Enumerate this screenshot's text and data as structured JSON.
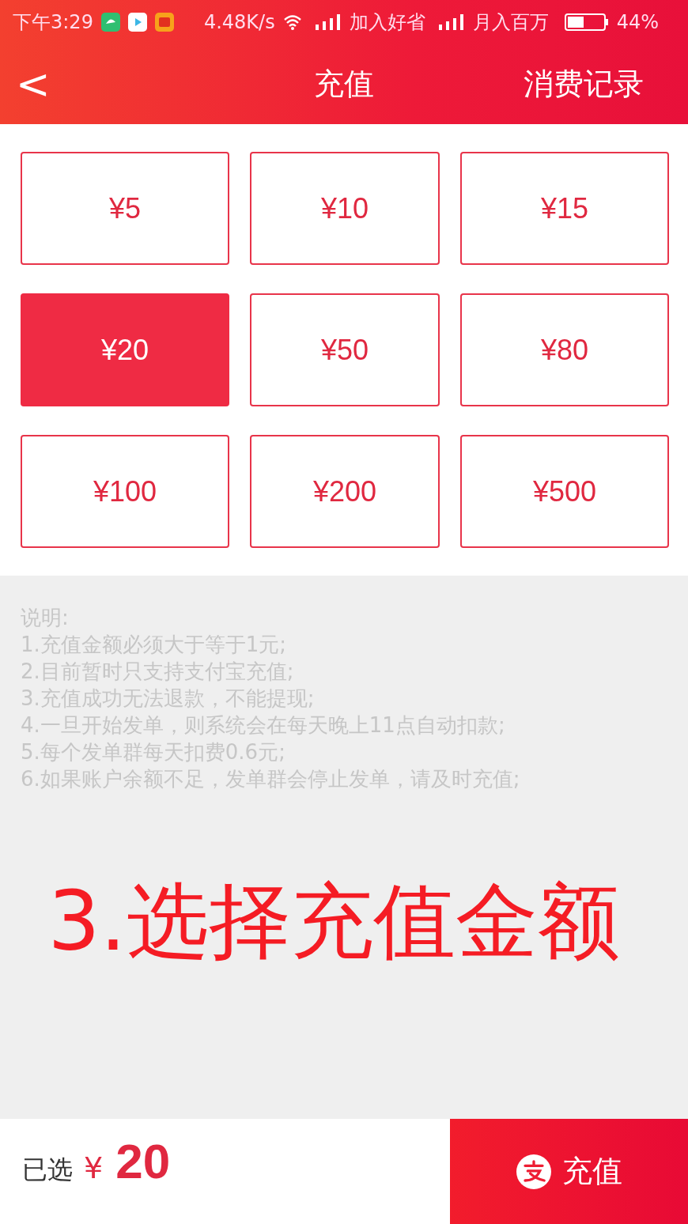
{
  "status_bar": {
    "time": "下午3:29",
    "speed": "4.48K/s",
    "carrier_1": "加入好省",
    "carrier_2": "月入百万",
    "battery": "44%"
  },
  "header": {
    "back": "<",
    "title": "充值",
    "action": "消费记录"
  },
  "amounts": [
    {
      "label": "¥5",
      "selected": false
    },
    {
      "label": "¥10",
      "selected": false
    },
    {
      "label": "¥15",
      "selected": false
    },
    {
      "label": "¥20",
      "selected": true
    },
    {
      "label": "¥50",
      "selected": false
    },
    {
      "label": "¥80",
      "selected": false
    },
    {
      "label": "¥100",
      "selected": false
    },
    {
      "label": "¥200",
      "selected": false
    },
    {
      "label": "¥500",
      "selected": false
    }
  ],
  "notes": [
    "说明:",
    "1.充值金额必须大于等于1元;",
    "2.目前暂时只支持支付宝充值;",
    "3.充值成功无法退款，不能提现;",
    "4.一旦开始发单，则系统会在每天晚上11点自动扣款;",
    "5.每个发单群每天扣费0.6元;",
    "6.如果账户余额不足，发单群会停止发单，请及时充值;"
  ],
  "annotation": "3.选择充值金额",
  "bottom_bar": {
    "selected_label": "已选",
    "currency": "¥",
    "amount": "20",
    "pay_button": "充值"
  }
}
